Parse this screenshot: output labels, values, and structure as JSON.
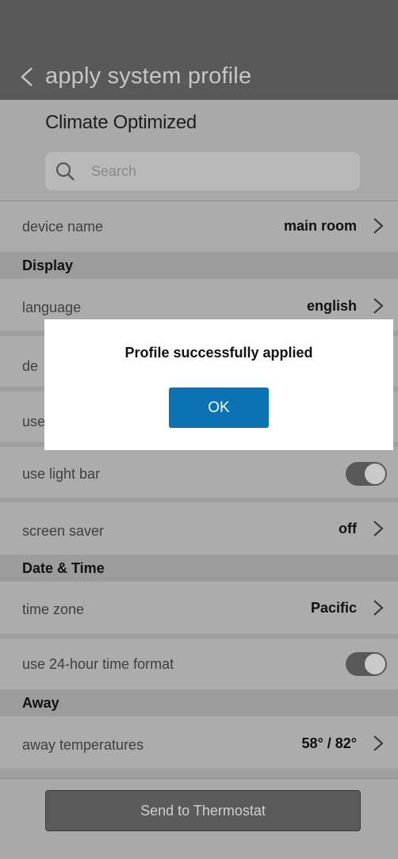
{
  "header": {
    "title": "apply system profile",
    "back_icon": "chevron-left-icon"
  },
  "profile": {
    "name": "Climate Optimized"
  },
  "search": {
    "placeholder": "Search",
    "icon": "search-icon"
  },
  "settings": {
    "device_name": {
      "label": "device name",
      "value": "main room"
    },
    "display_header": "Display",
    "language": {
      "label": "language",
      "value": "english"
    },
    "row_dec_partial": {
      "label": "de"
    },
    "row_use_partial": {
      "label": "use"
    },
    "light_bar": {
      "label": "use light bar",
      "on": true
    },
    "screen_saver": {
      "label": "screen saver",
      "value": "off"
    },
    "datetime_header": "Date & Time",
    "time_zone": {
      "label": "time zone",
      "value": "Pacific"
    },
    "time_format": {
      "label": "use 24-hour time format",
      "on": true
    },
    "away_header": "Away",
    "away_temps": {
      "label": "away temperatures",
      "value": "58° / 82°"
    }
  },
  "footer": {
    "send_label": "Send to Thermostat"
  },
  "dialog": {
    "message": "Profile successfully applied",
    "ok_label": "OK"
  },
  "colors": {
    "accent": "#0b72b4",
    "overlay_gray": "#a9a9a9"
  }
}
